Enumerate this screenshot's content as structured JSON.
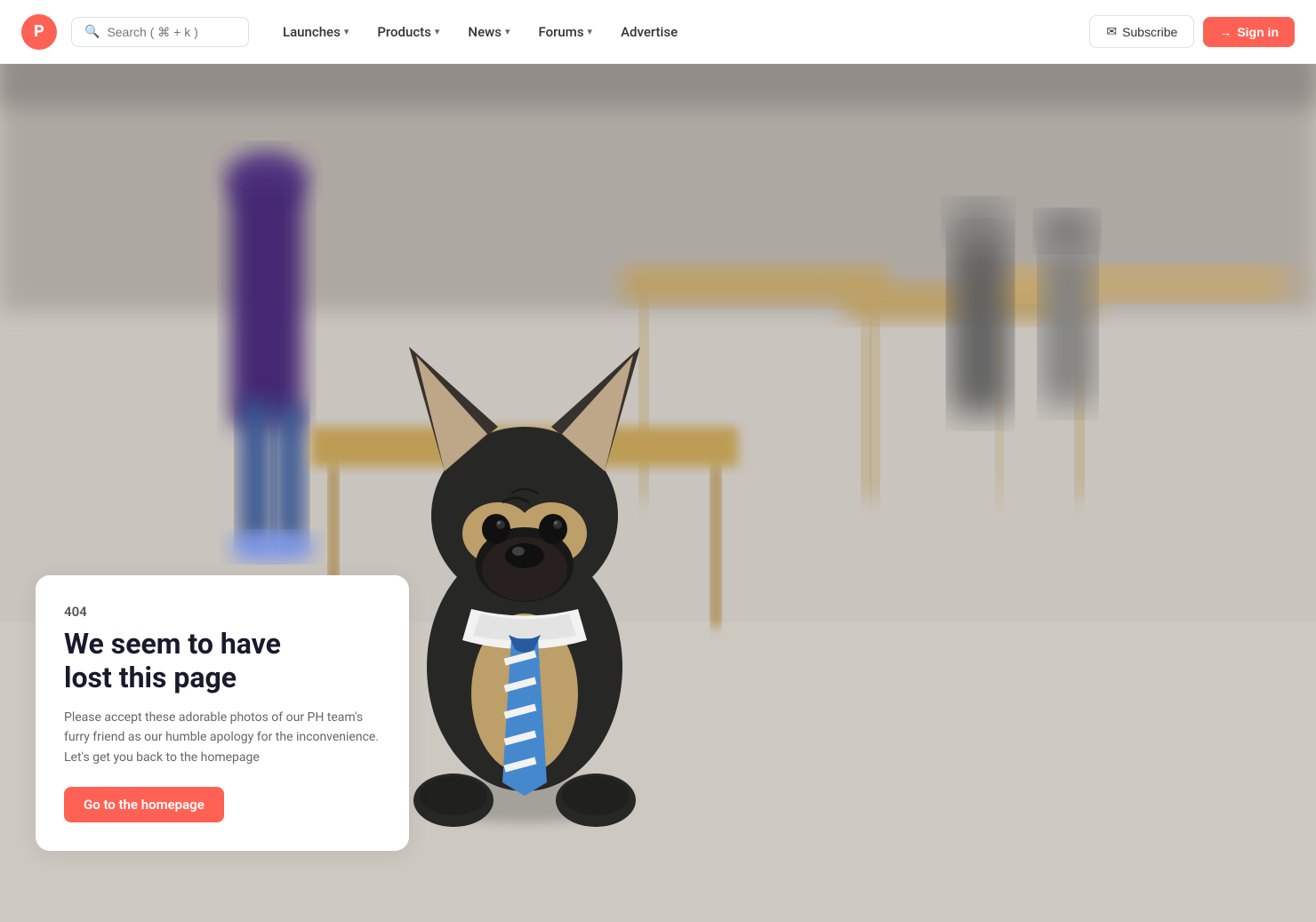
{
  "brand": {
    "logo_letter": "P",
    "logo_color": "#ff6154"
  },
  "search": {
    "placeholder": "Search ( ⌘ + k )"
  },
  "nav": {
    "items": [
      {
        "label": "Launches",
        "has_dropdown": true
      },
      {
        "label": "Products",
        "has_dropdown": true
      },
      {
        "label": "News",
        "has_dropdown": true
      },
      {
        "label": "Forums",
        "has_dropdown": true
      },
      {
        "label": "Advertise",
        "has_dropdown": false
      }
    ]
  },
  "actions": {
    "subscribe_label": "Subscribe",
    "signin_label": "Sign in"
  },
  "error_page": {
    "code": "404",
    "title_line1": "We seem to have",
    "title_line2": "lost this page",
    "description": "Please accept these adorable photos of our PH team's furry friend as our humble apology for the inconvenience. Let's get you back to the homepage",
    "cta_label": "Go to the homepage"
  }
}
